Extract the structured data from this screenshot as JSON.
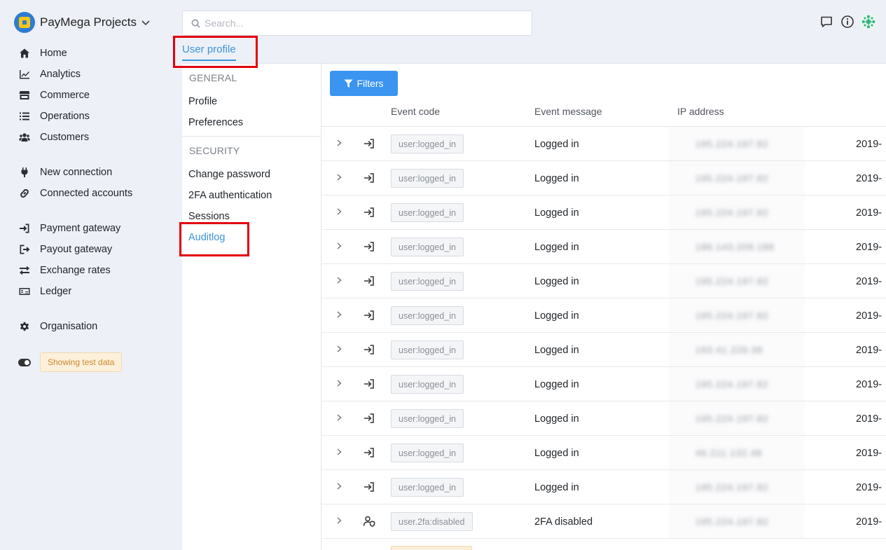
{
  "brand": {
    "name": "PayMega Projects"
  },
  "nav": {
    "home": "Home",
    "analytics": "Analytics",
    "commerce": "Commerce",
    "operations": "Operations",
    "customers": "Customers",
    "new_connection": "New connection",
    "connected_accounts": "Connected accounts",
    "payment_gateway": "Payment gateway",
    "payout_gateway": "Payout gateway",
    "exchange_rates": "Exchange rates",
    "ledger": "Ledger",
    "organisation": "Organisation"
  },
  "test_data_badge": "Showing test data",
  "search": {
    "placeholder": "Search..."
  },
  "tab": {
    "label": "User profile"
  },
  "submenu": {
    "general_heading": "GENERAL",
    "profile": "Profile",
    "preferences": "Preferences",
    "security_heading": "SECURITY",
    "change_password": "Change password",
    "twofa": "2FA authentication",
    "sessions": "Sessions",
    "auditlog": "Auditlog"
  },
  "table": {
    "filters_label": "Filters",
    "headers": {
      "event_code": "Event code",
      "event_message": "Event message",
      "ip_address": "IP address"
    },
    "rows": [
      {
        "icon": "login-icon",
        "code": "user:logged_in",
        "message": "Logged in",
        "ip": "195.224.197.82",
        "date": "2019-"
      },
      {
        "icon": "login-icon",
        "code": "user:logged_in",
        "message": "Logged in",
        "ip": "195.224.197.82",
        "date": "2019-"
      },
      {
        "icon": "login-icon",
        "code": "user:logged_in",
        "message": "Logged in",
        "ip": "195.224.197.82",
        "date": "2019-"
      },
      {
        "icon": "login-icon",
        "code": "user:logged_in",
        "message": "Logged in",
        "ip": "186.143.209.188",
        "date": "2019-"
      },
      {
        "icon": "login-icon",
        "code": "user:logged_in",
        "message": "Logged in",
        "ip": "195.224.197.82",
        "date": "2019-"
      },
      {
        "icon": "login-icon",
        "code": "user:logged_in",
        "message": "Logged in",
        "ip": "195.224.197.82",
        "date": "2019-"
      },
      {
        "icon": "login-icon",
        "code": "user:logged_in",
        "message": "Logged in",
        "ip": "193.41.229.38",
        "date": "2019-"
      },
      {
        "icon": "login-icon",
        "code": "user:logged_in",
        "message": "Logged in",
        "ip": "195.224.197.82",
        "date": "2019-"
      },
      {
        "icon": "login-icon",
        "code": "user:logged_in",
        "message": "Logged in",
        "ip": "195.224.197.82",
        "date": "2019-"
      },
      {
        "icon": "login-icon",
        "code": "user:logged_in",
        "message": "Logged in",
        "ip": "46.211.132.48",
        "date": "2019-"
      },
      {
        "icon": "login-icon",
        "code": "user:logged_in",
        "message": "Logged in",
        "ip": "195.224.197.82",
        "date": "2019-"
      },
      {
        "icon": "user-shield-icon",
        "code": "user.2fa:disabled",
        "message": "2FA disabled",
        "ip": "195.224.197.82",
        "date": "2019-"
      }
    ]
  }
}
